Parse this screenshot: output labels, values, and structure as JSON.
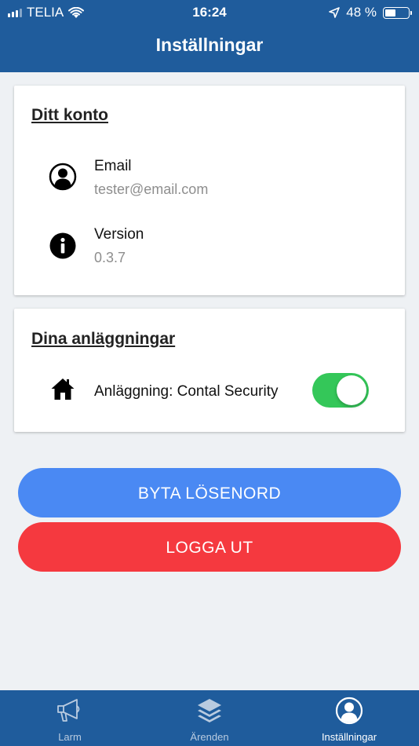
{
  "status_bar": {
    "carrier": "TELIA",
    "time": "16:24",
    "battery_percent": "48 %",
    "battery_level": 0.48,
    "icons": [
      "signal-icon",
      "wifi-icon",
      "location-arrow-icon",
      "battery-icon"
    ]
  },
  "header": {
    "title": "Inställningar"
  },
  "account_card": {
    "title": "Ditt konto",
    "email": {
      "label": "Email",
      "value": "tester@email.com",
      "icon": "user-icon"
    },
    "version": {
      "label": "Version",
      "value": "0.3.7",
      "icon": "info-icon"
    }
  },
  "facilities_card": {
    "title": "Dina anläggningar",
    "facility": {
      "label": "Anläggning: Contal Security",
      "icon": "home-icon",
      "enabled": true
    }
  },
  "buttons": {
    "change_password": "BYTA LÖSENORD",
    "logout": "LOGGA UT"
  },
  "tabs": [
    {
      "label": "Larm",
      "icon": "megaphone-icon",
      "active": false
    },
    {
      "label": "Ärenden",
      "icon": "layers-icon",
      "active": false
    },
    {
      "label": "Inställningar",
      "icon": "user-icon",
      "active": true
    }
  ],
  "colors": {
    "header": "#1f5c9c",
    "background": "#eef1f4",
    "toggle_on": "#34c759",
    "primary_button": "#4a89f3",
    "danger_button": "#f5393f"
  }
}
